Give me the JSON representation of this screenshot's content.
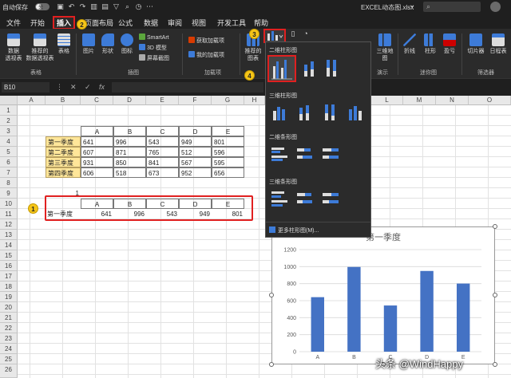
{
  "titlebar": {
    "autosave_label": "自动保存",
    "toggle_state": "关",
    "filename": "EXCEL动态图.xlsx",
    "dropdown_mark": "⌄",
    "search_placeholder": ""
  },
  "tabs": [
    "文件",
    "开始",
    "插入",
    "页面布局",
    "公式",
    "数据",
    "审阅",
    "视图",
    "开发工具",
    "帮助"
  ],
  "active_tab": "插入",
  "ribbon": {
    "tables": [
      "数据\n透视表",
      "推荐的\n数据透视表",
      "表格"
    ],
    "tables_group": "表格",
    "illus": [
      "图片",
      "形状",
      "图标"
    ],
    "illus_small": [
      "SmartArt",
      "3D 模型",
      "屏幕截图"
    ],
    "illus_group": "插图",
    "addins": [
      "获取加载项",
      "我的加载项"
    ],
    "addins_group": "加载项",
    "charts_recommended": "推荐的\n图表",
    "map_label": "三维地\n图",
    "spark": [
      "折线",
      "柱形",
      "盈亏"
    ],
    "spark_group": "迷你图",
    "filters": [
      "切片器",
      "日程表"
    ],
    "filters_group": "筛选器",
    "demo_group": "演示"
  },
  "formula_bar": {
    "name_box": "B10",
    "fx": "fx"
  },
  "columns": [
    "A",
    "B",
    "C",
    "D",
    "E",
    "F",
    "G",
    "H",
    "I",
    "J",
    "K",
    "L",
    "M",
    "N",
    "O"
  ],
  "rows": [
    "1",
    "2",
    "3",
    "4",
    "5",
    "6",
    "7",
    "8",
    "9",
    "10",
    "11",
    "12",
    "13",
    "14",
    "15",
    "16",
    "17",
    "18",
    "19",
    "20",
    "21",
    "22",
    "23",
    "24",
    "25",
    "26"
  ],
  "table1": {
    "headers": [
      "A",
      "B",
      "C",
      "D",
      "E"
    ],
    "rows": [
      {
        "label": "第一季度",
        "values": [
          "641",
          "996",
          "543",
          "949",
          "801"
        ]
      },
      {
        "label": "第二季度",
        "values": [
          "607",
          "871",
          "765",
          "512",
          "596"
        ]
      },
      {
        "label": "第三季度",
        "values": [
          "931",
          "850",
          "841",
          "567",
          "595"
        ]
      },
      {
        "label": "第四季度",
        "values": [
          "606",
          "518",
          "673",
          "952",
          "656"
        ]
      }
    ]
  },
  "b9_value": "1",
  "table2": {
    "headers": [
      "A",
      "B",
      "C",
      "D",
      "E"
    ],
    "label": "第一季度",
    "values": [
      "641",
      "996",
      "543",
      "949",
      "801"
    ]
  },
  "callouts": [
    "1",
    "2",
    "3",
    "4"
  ],
  "dropdown": {
    "sections": [
      "二维柱形图",
      "三维柱形图",
      "二维条形图",
      "三维条形图"
    ],
    "more_label": "更多柱形图(M)..."
  },
  "chart_data": {
    "type": "bar",
    "title": "第一季度",
    "categories": [
      "A",
      "B",
      "C",
      "D",
      "E"
    ],
    "values": [
      641,
      996,
      543,
      949,
      801
    ],
    "yticks": [
      "0",
      "200",
      "400",
      "600",
      "800",
      "1000",
      "1200"
    ],
    "ylim": [
      0,
      1200
    ],
    "bar_color": "#4472c4",
    "grid": true
  },
  "colors": {
    "accent": "#e02020",
    "highlight": "#ffe699",
    "callout": "#f5c518"
  },
  "watermark": "头条 @WindHappy"
}
